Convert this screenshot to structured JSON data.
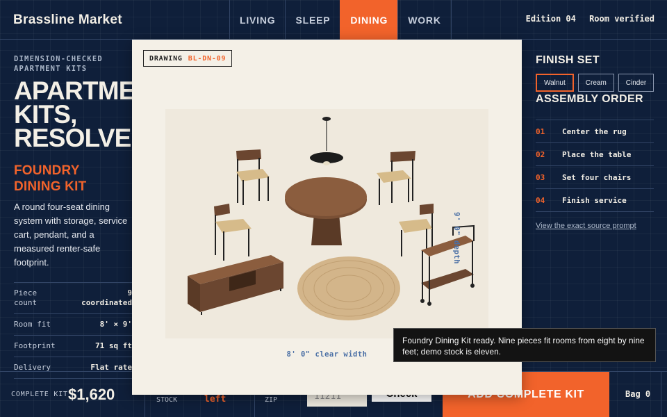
{
  "header": {
    "brand": "Brassline Market",
    "tabs": [
      {
        "label": "LIVING"
      },
      {
        "label": "SLEEP"
      },
      {
        "label": "DINING"
      },
      {
        "label": "WORK"
      }
    ],
    "active_tab": "DINING",
    "edition": "Edition 04",
    "status": "Room verified"
  },
  "hero": {
    "eyebrow_line1": "DIMENSION-CHECKED",
    "eyebrow_line2": "APARTMENT KITS",
    "headline_line1": "APARTMENT",
    "headline_line2": "KITS,",
    "headline_line3": "RESOLVED.",
    "kit_name_line1": "FOUNDRY",
    "kit_name_line2": "DINING KIT",
    "description": "A round four-seat dining system with storage, service cart, pendant, and a measured renter-safe footprint."
  },
  "specs": [
    {
      "label_line1": "Piece",
      "label_line2": "count",
      "value_line1": "9",
      "value_line2": "coordinated"
    },
    {
      "label_line1": "Room fit",
      "label_line2": "",
      "value_line1": "8' × 9'",
      "value_line2": ""
    },
    {
      "label_line1": "Footprint",
      "label_line2": "",
      "value_line1": "71 sq ft",
      "value_line2": ""
    },
    {
      "label_line1": "Delivery",
      "label_line2": "",
      "value_line1": "Flat rate",
      "value_line2": ""
    }
  ],
  "drawing": {
    "tag_label": "DRAWING",
    "tag_code": "BL-DN-09",
    "width_label": "8' 0\" clear width",
    "depth_label": "9' 0\" depth"
  },
  "finish": {
    "title": "FINISH SET",
    "options": [
      {
        "label": "Walnut"
      },
      {
        "label": "Cream"
      },
      {
        "label": "Cinder"
      }
    ],
    "selected": "Walnut"
  },
  "assembly": {
    "title": "ASSEMBLY ORDER",
    "steps": [
      {
        "num": "01",
        "label": "Center the rug"
      },
      {
        "num": "02",
        "label": "Place the table"
      },
      {
        "num": "03",
        "label": "Set four chairs"
      },
      {
        "num": "04",
        "label": "Finish service"
      }
    ],
    "source_link": "View the exact source prompt"
  },
  "footer": {
    "total_label": "COMPLETE KIT",
    "total_price": "$1,620",
    "stock_label": "STOCK",
    "stock_value": "left",
    "zip_label": "ZIP",
    "zip_value": "11211",
    "check_label": "Check",
    "add_label": "ADD COMPLETE KIT",
    "bag_label": "Bag 0"
  },
  "toast": {
    "message": "Foundry Dining Kit ready. Nine pieces fit rooms from eight by nine feet; demo stock is eleven."
  },
  "colors": {
    "background": "#0f1f3a",
    "accent": "#f2632b",
    "paper": "#f4f0e7",
    "dimension": "#4a6fa5",
    "walnut": "#6b4630"
  }
}
